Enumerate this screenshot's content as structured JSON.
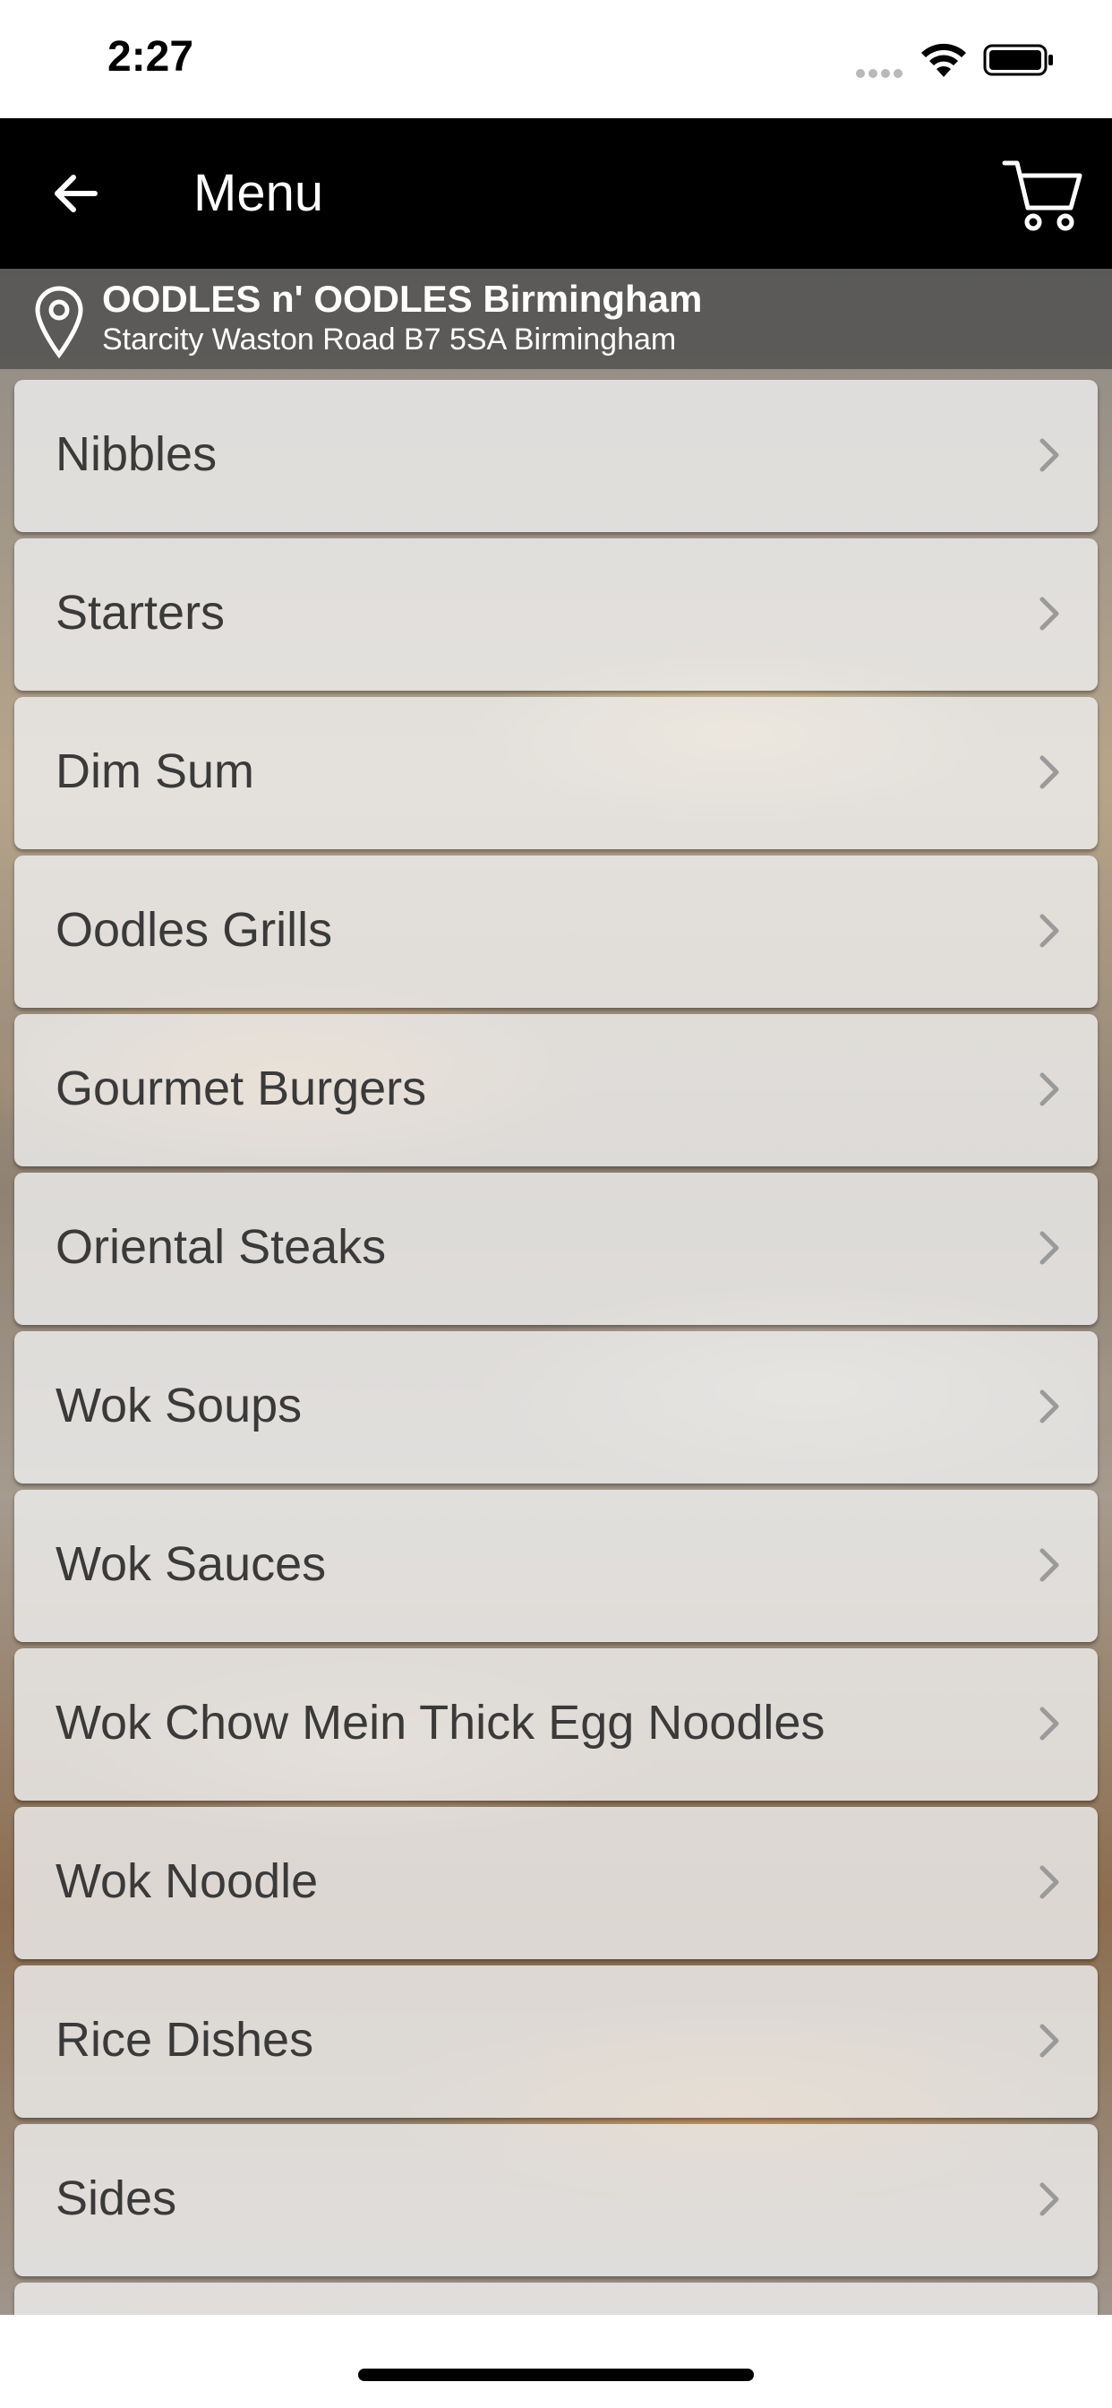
{
  "status_bar": {
    "time": "2:27"
  },
  "header": {
    "title": "Menu",
    "back_icon": "arrow-left-icon",
    "cart_icon": "shopping-cart-icon",
    "background_color": "#000000"
  },
  "location": {
    "icon": "location-pin-icon",
    "name": "OODLES n' OODLES Birmingham",
    "address": "Starcity Waston Road B7 5SA Birmingham"
  },
  "menu": {
    "item_icon": "chevron-right-icon",
    "items": [
      {
        "label": "Nibbles"
      },
      {
        "label": "Starters"
      },
      {
        "label": "Dim Sum"
      },
      {
        "label": "Oodles Grills"
      },
      {
        "label": "Gourmet Burgers"
      },
      {
        "label": "Oriental Steaks"
      },
      {
        "label": "Wok Soups"
      },
      {
        "label": "Wok Sauces"
      },
      {
        "label": "Wok Chow Mein Thick Egg Noodles"
      },
      {
        "label": "Wok Noodle"
      },
      {
        "label": "Rice Dishes"
      },
      {
        "label": "Sides"
      },
      {
        "label": ""
      }
    ]
  }
}
